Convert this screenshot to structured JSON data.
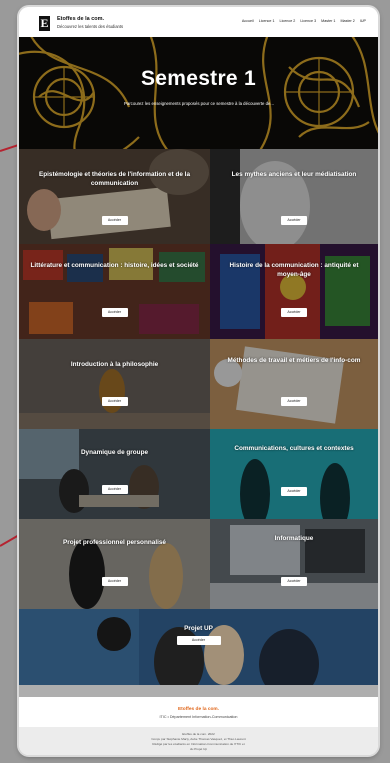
{
  "header": {
    "logo_letter": "E",
    "site_title": "Etoffes de la com.",
    "site_tagline": "Découvrez les talents des étudiants",
    "nav": [
      "Accueil",
      "Licence 1",
      "Licence 2",
      "Licence 3",
      "Master 1",
      "Master 2",
      "IUP"
    ]
  },
  "hero": {
    "title": "Semestre 1",
    "subtitle": "Parcourez les enseignements proposés pour ce semestre à la découverte de..."
  },
  "tiles": [
    {
      "title": "Epistémologie et théories de l'information et de la communication",
      "button": "Accéder"
    },
    {
      "title": "Les mythes anciens et leur médiatisation",
      "button": "Accéder"
    },
    {
      "title": "Littérature et communication : histoire, idées et société",
      "button": "Accéder"
    },
    {
      "title": "Histoire de la communication : antiquité et moyen-âge",
      "button": "Accéder"
    },
    {
      "title": "Introduction à la philosophie",
      "button": "Accéder"
    },
    {
      "title": "Méthodes de travail et métiers de l'info-com",
      "button": "Accéder"
    },
    {
      "title": "Dynamique de groupe",
      "button": "Accéder"
    },
    {
      "title": "Communications, cultures et contextes",
      "button": "Accéder"
    },
    {
      "title": "Projet professionnel personnalisé",
      "button": "Accéder"
    },
    {
      "title": "Informatique",
      "button": "Accéder"
    },
    {
      "title": "Projet UP",
      "button": "Accéder"
    }
  ],
  "footer": {
    "brand": "Etoffes de la com.",
    "dept": "ITIC • Département Information-Communication",
    "copyright": "Etoffes de la com. 2022",
    "credits_1": "Conçu par Stéphanie Marty, Aube Thomas Vasquez, et Théo Laurent",
    "credits_2": "Rédigé par les étudiants en Information-Communication de l'ITIC et",
    "credits_3": "du Projet Up"
  },
  "colors": {
    "accent": "#e0671c",
    "hero_gold": "#d9a62a",
    "background": "#9a9a9a",
    "annotation_line": "#b52330"
  }
}
